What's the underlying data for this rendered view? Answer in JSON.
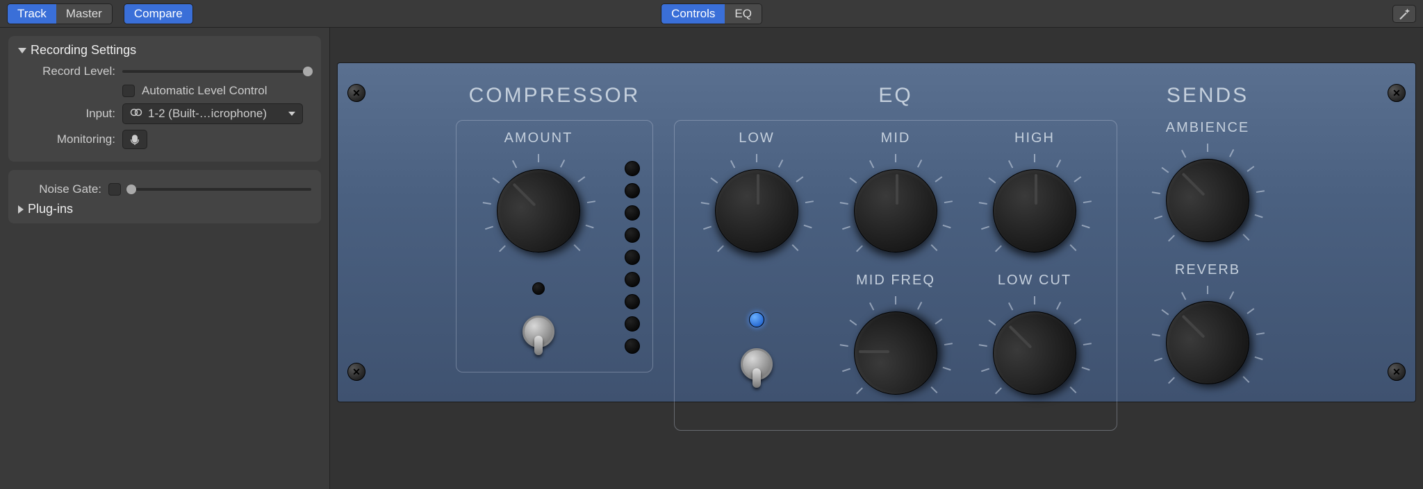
{
  "topbar": {
    "track": "Track",
    "master": "Master",
    "compare": "Compare",
    "controls": "Controls",
    "eq": "EQ"
  },
  "sidebar": {
    "recording_settings": "Recording Settings",
    "record_level": "Record Level:",
    "auto_level": "Automatic Level Control",
    "input_label": "Input:",
    "input_value": "1-2  (Built-…icrophone)",
    "monitoring": "Monitoring:",
    "noise_gate": "Noise Gate:",
    "plugins": "Plug-ins",
    "record_level_value": 100,
    "noise_gate_value": 2
  },
  "rack": {
    "compressor": {
      "title": "COMPRESSOR",
      "amount": "AMOUNT",
      "amount_angle": -45
    },
    "eq": {
      "title": "EQ",
      "low": "LOW",
      "mid": "MID",
      "high": "HIGH",
      "mid_freq": "MID FREQ",
      "low_cut": "LOW CUT",
      "low_angle": 0,
      "mid_angle": 0,
      "high_angle": 0,
      "mid_freq_angle": -90,
      "low_cut_angle": -45
    },
    "sends": {
      "title": "SENDS",
      "ambience": "AMBIENCE",
      "reverb": "REVERB",
      "ambience_angle": -45,
      "reverb_angle": -45
    }
  }
}
